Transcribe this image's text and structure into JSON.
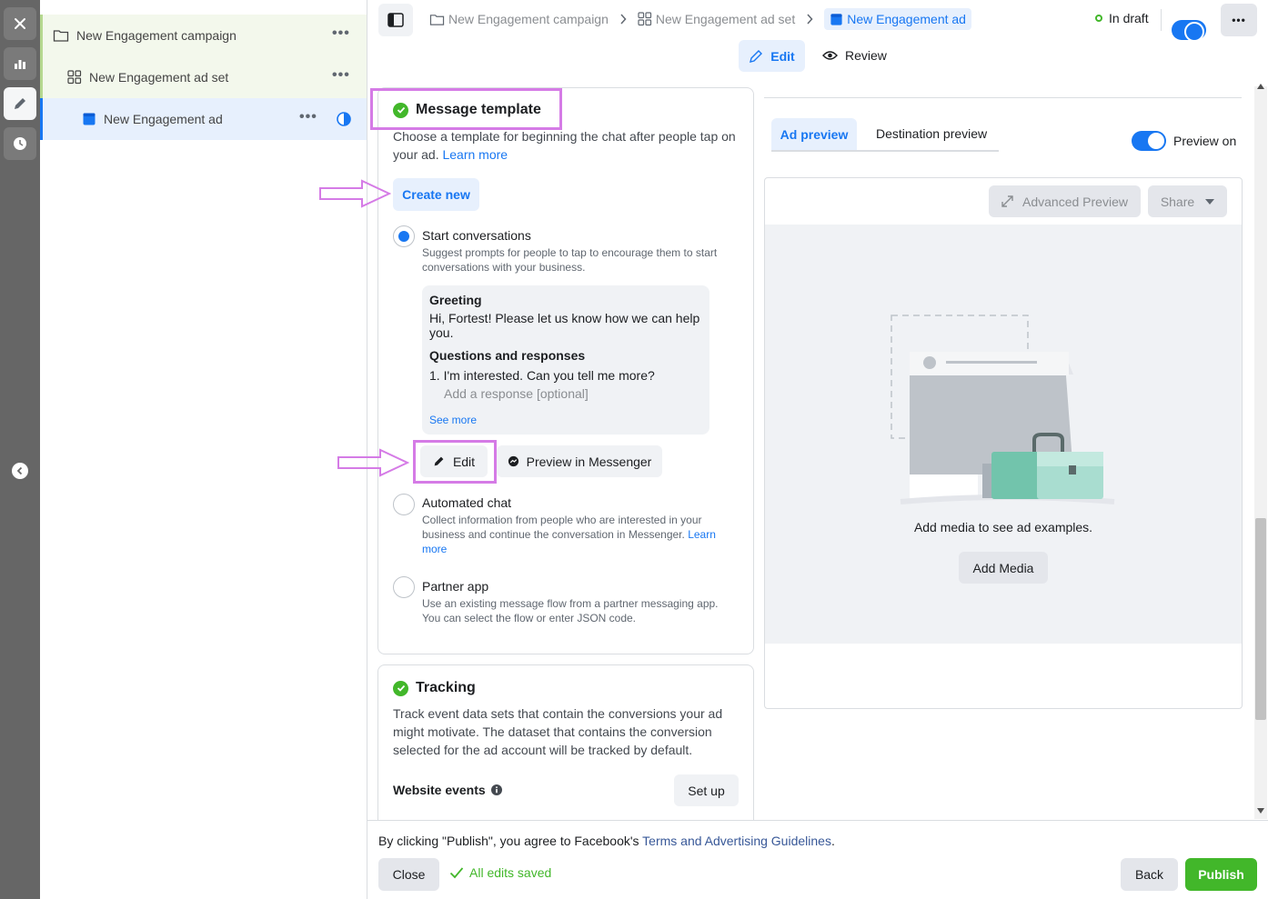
{
  "tree": {
    "campaign": "New Engagement campaign",
    "adset": "New Engagement ad set",
    "ad": "New Engagement ad"
  },
  "breadcrumb": {
    "campaign": "New Engagement campaign",
    "adset": "New Engagement ad set",
    "ad": "New Engagement ad"
  },
  "status": {
    "label": "In draft"
  },
  "mode_tabs": {
    "edit": "Edit",
    "review": "Review"
  },
  "message_template": {
    "title": "Message template",
    "description": "Choose a template for beginning the chat after people tap on your ad.",
    "learn_more": "Learn more",
    "create_new": "Create new",
    "options": [
      {
        "title": "Start conversations",
        "desc": "Suggest prompts for people to tap to encourage them to start conversations with your business.",
        "selected": true
      },
      {
        "title": "Automated chat",
        "desc": "Collect information from people who are interested in your business and continue the conversation in Messenger.",
        "learn": "Learn more",
        "selected": false
      },
      {
        "title": "Partner app",
        "desc": "Use an existing message flow from a partner messaging app. You can select the flow or enter JSON code.",
        "selected": false
      }
    ],
    "summary": {
      "greeting_label": "Greeting",
      "greeting_text": "Hi, Fortest! Please let us know how we can help you.",
      "qa_label": "Questions and responses",
      "question": "1. I'm interested. Can you tell me more?",
      "response_placeholder": "Add a response [optional]",
      "see_more": "See more"
    },
    "edit_button": "Edit",
    "preview_button": "Preview in Messenger"
  },
  "tracking": {
    "title": "Tracking",
    "description": "Track event data sets that contain the conversions your ad might motivate. The dataset that contains the conversion selected for the ad account will be tracked by default.",
    "website_events": "Website events",
    "setup": "Set up"
  },
  "preview": {
    "tabs": {
      "ad": "Ad preview",
      "destination": "Destination preview"
    },
    "toggle_label": "Preview on",
    "advanced": "Advanced Preview",
    "share": "Share",
    "empty_text": "Add media to see ad examples.",
    "add_media": "Add Media"
  },
  "footer": {
    "agreement_prefix": "By clicking \"Publish\", you agree to Facebook's ",
    "agreement_link": "Terms and Advertising Guidelines",
    "agreement_suffix": ".",
    "close": "Close",
    "saved": "All edits saved",
    "back": "Back",
    "publish": "Publish"
  },
  "colors": {
    "accent": "#1877f2",
    "success": "#42b72a",
    "highlight": "#d57be6"
  }
}
